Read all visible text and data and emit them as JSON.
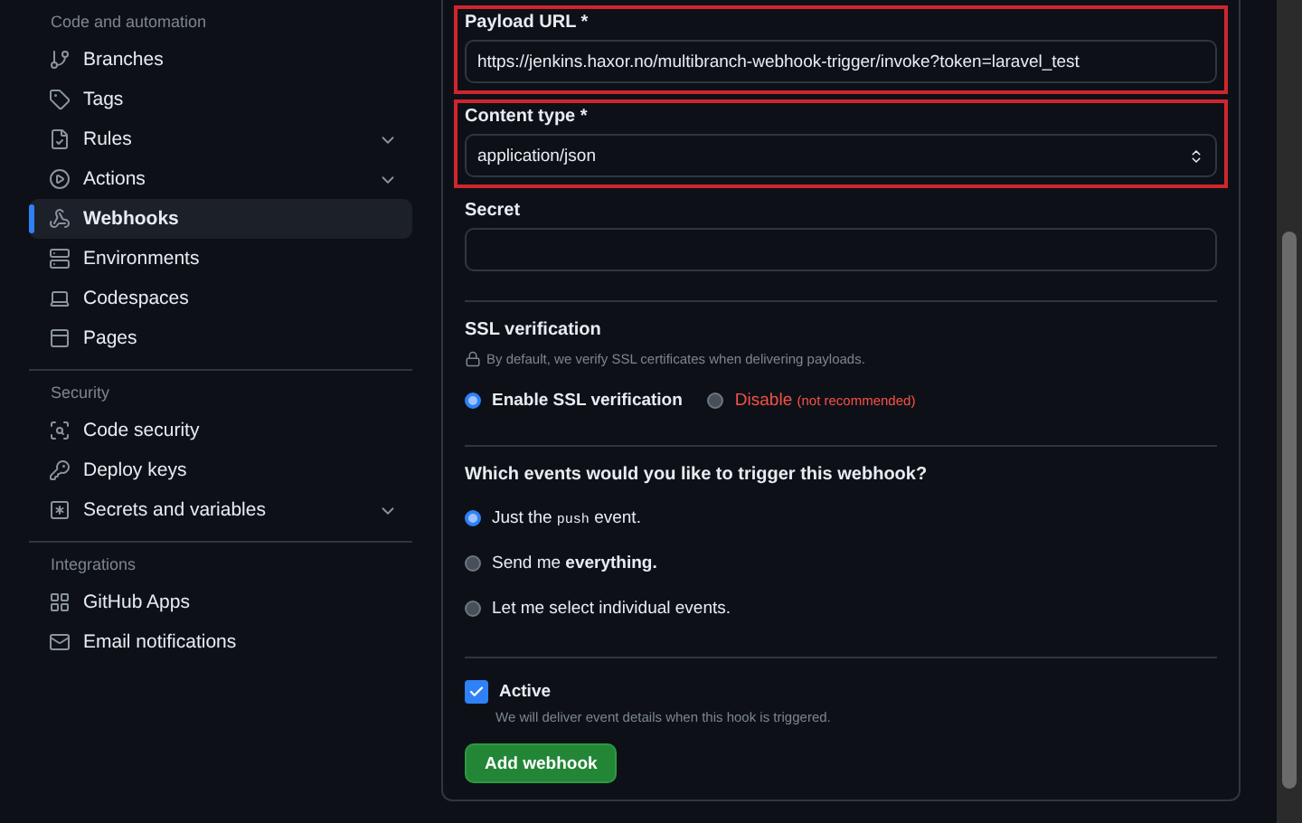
{
  "sidebar": {
    "sections": [
      {
        "title": "Code and automation",
        "items": [
          {
            "label": "Branches",
            "selected": false,
            "expandable": false
          },
          {
            "label": "Tags",
            "selected": false,
            "expandable": false
          },
          {
            "label": "Rules",
            "selected": false,
            "expandable": true
          },
          {
            "label": "Actions",
            "selected": false,
            "expandable": true
          },
          {
            "label": "Webhooks",
            "selected": true,
            "expandable": false
          },
          {
            "label": "Environments",
            "selected": false,
            "expandable": false
          },
          {
            "label": "Codespaces",
            "selected": false,
            "expandable": false
          },
          {
            "label": "Pages",
            "selected": false,
            "expandable": false
          }
        ]
      },
      {
        "title": "Security",
        "items": [
          {
            "label": "Code security",
            "selected": false,
            "expandable": false
          },
          {
            "label": "Deploy keys",
            "selected": false,
            "expandable": false
          },
          {
            "label": "Secrets and variables",
            "selected": false,
            "expandable": true
          }
        ]
      },
      {
        "title": "Integrations",
        "items": [
          {
            "label": "GitHub Apps",
            "selected": false,
            "expandable": false
          },
          {
            "label": "Email notifications",
            "selected": false,
            "expandable": false
          }
        ]
      }
    ]
  },
  "form": {
    "fields": [
      {
        "kind": "text",
        "label": "Payload URL *",
        "value": "https://jenkins.haxor.no/multibranch-webhook-trigger/invoke?token=laravel_test",
        "highlighted": true
      },
      {
        "kind": "select",
        "label": "Content type *",
        "value": "application/json",
        "highlighted": true
      },
      {
        "kind": "text",
        "label": "Secret",
        "highlighted": false
      }
    ],
    "ssl": {
      "title": "SSL verification",
      "note": "By default, we verify SSL certificates when delivering payloads.",
      "options": [
        {
          "label": "Enable SSL verification",
          "kind": "safe",
          "selected": true
        },
        {
          "label": "Disable",
          "hint": "(not recommended)",
          "kind": "danger",
          "selected": false
        }
      ]
    },
    "events": {
      "question": "Which events would you like to trigger this webhook?",
      "options": [
        {
          "parts": [
            {
              "kind": "plain",
              "text": "Just the "
            },
            {
              "kind": "code",
              "text": "push"
            },
            {
              "kind": "plain",
              "text": " event."
            }
          ],
          "selected": true
        },
        {
          "parts": [
            {
              "kind": "plain",
              "text": "Send me "
            },
            {
              "kind": "bold",
              "text": "everything."
            }
          ],
          "selected": false
        },
        {
          "parts": [
            {
              "kind": "plain",
              "text": "Let me select individual events."
            }
          ],
          "selected": false
        }
      ]
    },
    "active": {
      "label": "Active",
      "checked": true,
      "description": "We will deliver event details when this hook is triggered."
    },
    "submit": "Add webhook"
  }
}
